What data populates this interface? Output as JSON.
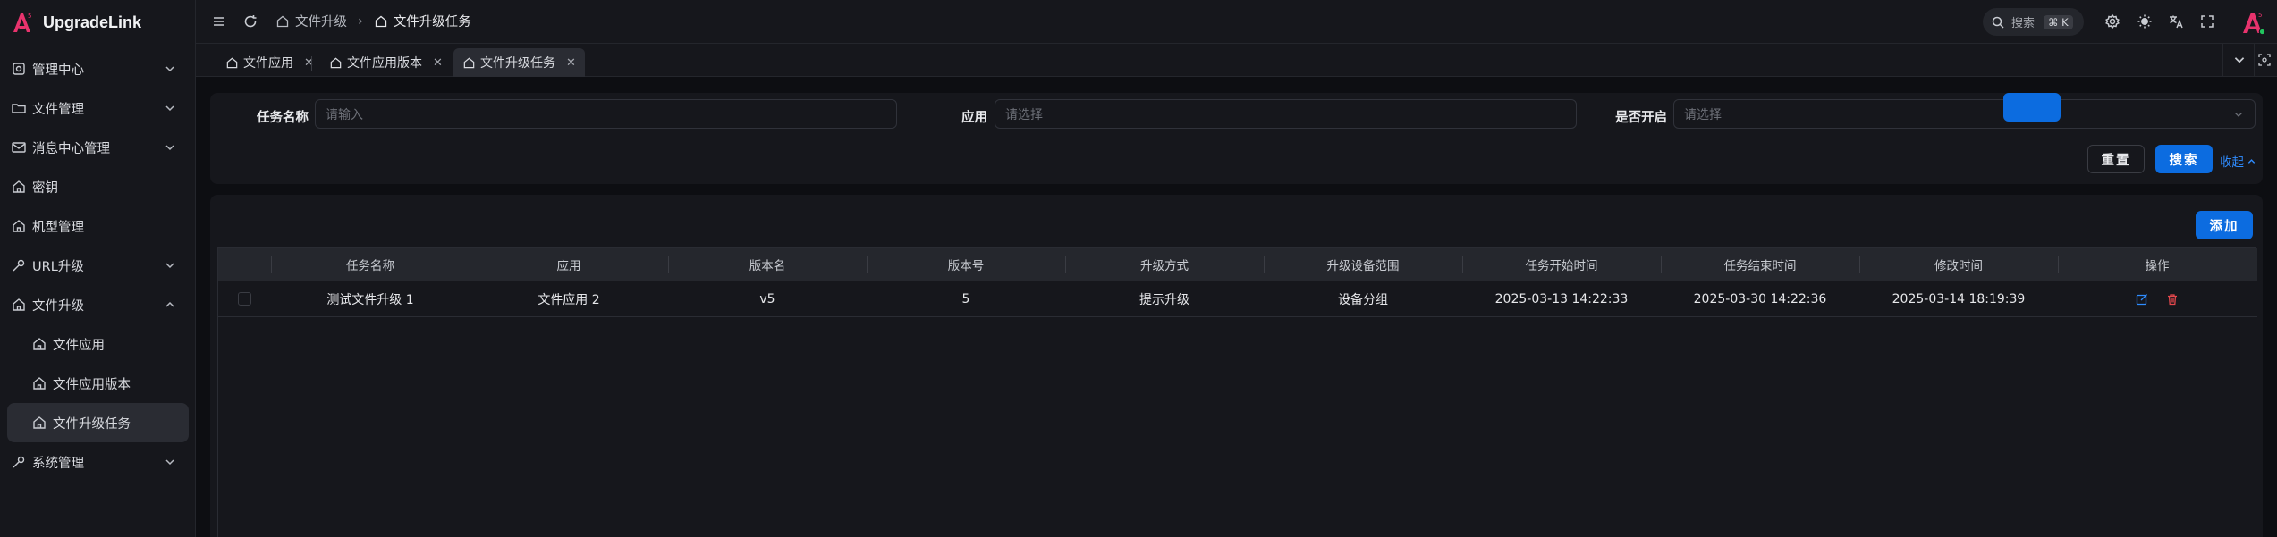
{
  "app": {
    "name": "UpgradeLink"
  },
  "sidebar": {
    "items": [
      {
        "label": "管理中心",
        "icon": "management-icon",
        "expandable": true
      },
      {
        "label": "文件管理",
        "icon": "folder-icon",
        "expandable": true
      },
      {
        "label": "消息中心管理",
        "icon": "mail-icon",
        "expandable": true
      },
      {
        "label": "密钥",
        "icon": "home-icon",
        "expandable": false
      },
      {
        "label": "机型管理",
        "icon": "home-icon",
        "expandable": false
      },
      {
        "label": "URL升级",
        "icon": "wrench-icon",
        "expandable": true
      },
      {
        "label": "文件升级",
        "icon": "home-icon",
        "expandable": true,
        "expanded": true
      },
      {
        "label": "文件应用",
        "icon": "home-icon",
        "sub": true
      },
      {
        "label": "文件应用版本",
        "icon": "home-icon",
        "sub": true
      },
      {
        "label": "文件升级任务",
        "icon": "home-icon",
        "sub": true,
        "active": true
      },
      {
        "label": "系统管理",
        "icon": "wrench-icon",
        "expandable": true
      }
    ]
  },
  "topbar": {
    "breadcrumb": [
      "文件升级",
      "文件升级任务"
    ],
    "search_label": "搜索",
    "search_shortcut": "⌘ K"
  },
  "tabs": [
    {
      "label": "文件应用",
      "active": false
    },
    {
      "label": "文件应用版本",
      "active": false
    },
    {
      "label": "文件升级任务",
      "active": true
    }
  ],
  "filters": {
    "task_name_label": "任务名称",
    "task_name_placeholder": "请输入",
    "app_label": "应用",
    "app_placeholder": "请选择",
    "enabled_label": "是否开启",
    "enabled_placeholder": "请选择",
    "reset_label": "重置",
    "search_label": "搜索",
    "collapse_label": "收起"
  },
  "table": {
    "add_label": "添加",
    "columns": [
      "任务名称",
      "应用",
      "版本名",
      "版本号",
      "升级方式",
      "升级设备范围",
      "任务开始时间",
      "任务结束时间",
      "修改时间",
      "操作"
    ],
    "rows": [
      [
        "测试文件升级 1",
        "文件应用 2",
        "v5",
        "5",
        "提示升级",
        "设备分组",
        "2025-03-13 14:22:33",
        "2025-03-30 14:22:36",
        "2025-03-14 18:19:39"
      ]
    ]
  },
  "colors": {
    "primary": "#0c6ce0",
    "link": "#2f8cff",
    "brand": "#e8336d",
    "danger": "#e5484d",
    "online": "#22c55e"
  }
}
